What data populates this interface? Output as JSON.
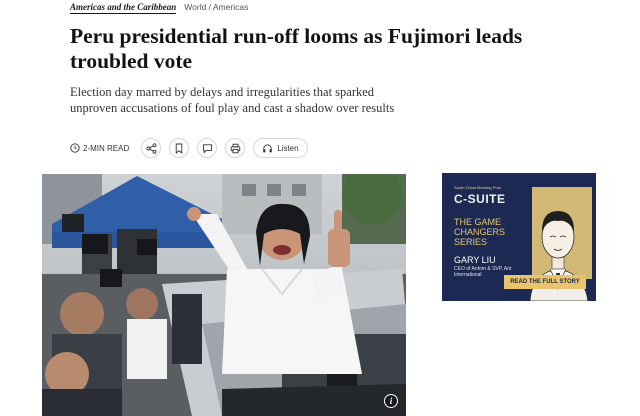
{
  "breadcrumb": {
    "section": "Americas and the Caribbean",
    "path": "World / Americas"
  },
  "article": {
    "headline": "Peru presidential run-off looms as Fujimori leads troubled vote",
    "standfirst": "Election day marred by delays and irregularities that sparked unproven accusations of foul play and cast a shadow over results"
  },
  "toolbar": {
    "read_time": "2-MIN READ",
    "listen_label": "Listen",
    "icons": [
      "clock-icon",
      "share-icon",
      "bookmark-icon",
      "comment-icon",
      "print-icon",
      "headphones-icon"
    ]
  },
  "photo": {
    "info_glyph": "i"
  },
  "ad": {
    "brand": "South China Morning Post",
    "logo_text": "C-SUITE",
    "series": "THE GAME CHANGERS SERIES",
    "name": "GARY LIU",
    "role": "CEO of Antom & SVP, Ant International",
    "cta": "READ THE FULL STORY",
    "colors": {
      "background": "#1c2952",
      "accent": "#e9c46a"
    }
  }
}
